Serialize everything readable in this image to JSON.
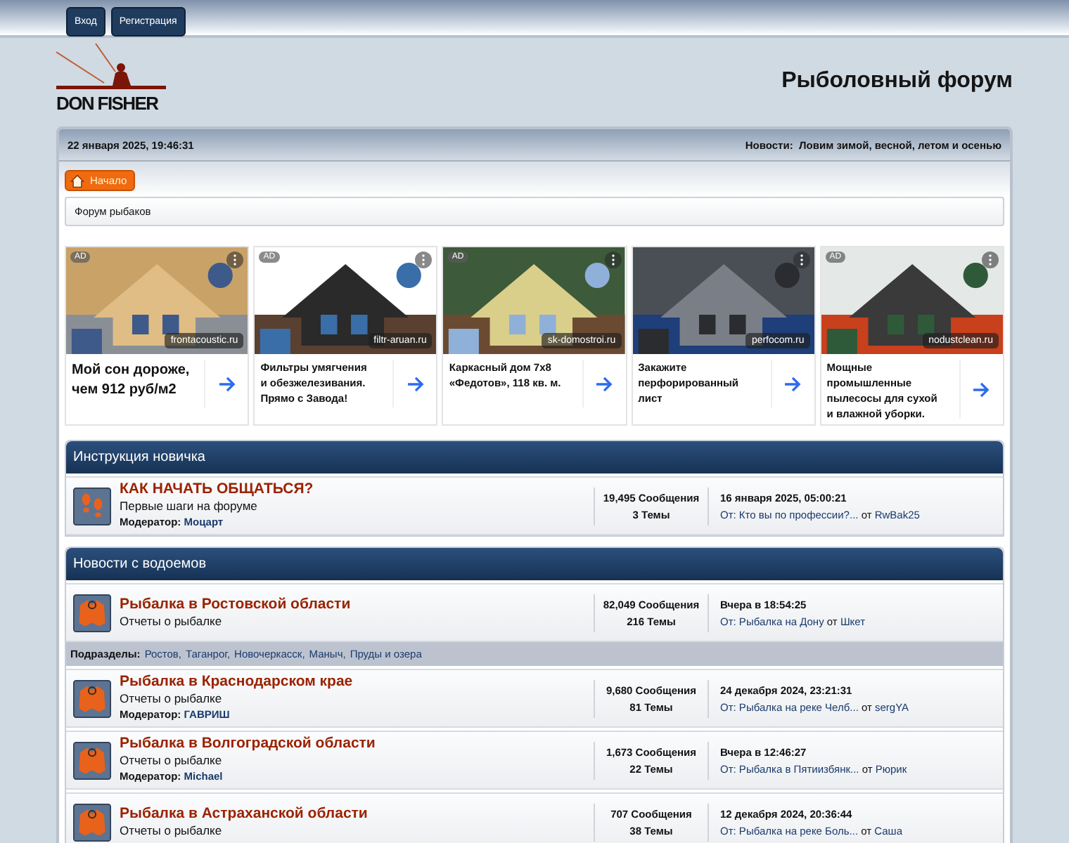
{
  "top_bar": {
    "buttons": [
      "Вход",
      "Регистрация"
    ]
  },
  "header": {
    "logo_text": "DON FISHER",
    "title": "Рыболовный форум"
  },
  "info_bar": {
    "datetime": "22 января 2025, 19:46:31",
    "news_label": "Новости:",
    "news": "Ловим зимой, весной, летом и осенью"
  },
  "home_button": "Начало",
  "breadcrumb": "Форум рыбаков",
  "ads": [
    {
      "kind": "headline",
      "badge": "AD",
      "domain": "frontacoustic.ru",
      "text": "Мой сон дороже,\nчем 912 руб/м2"
    },
    {
      "kind": "text",
      "badge": "AD",
      "domain": "filtr-aruan.ru",
      "text": "Фильтры умягчения\nи обезжелезивания.\nПрямо с Завода!"
    },
    {
      "kind": "text",
      "badge": "AD",
      "domain": "sk-domostroi.ru",
      "text": "Каркасный дом 7х8\n«Федотов», 118 кв. м."
    },
    {
      "kind": "text",
      "domain": "perfocom.ru",
      "text": "Закажите\nперфорированный\nлист"
    },
    {
      "kind": "text",
      "badge": "AD",
      "domain": "nodustclean.ru",
      "text": "Мощные промышленные\nпылесосы для сухой\nи влажной уборки."
    }
  ],
  "categories": [
    {
      "title": "Инструкция новичка",
      "boards": [
        {
          "kind": "steps",
          "name": "КАК НАЧАТЬ ОБЩАТЬСЯ?",
          "description": "Первые шаги на форуме",
          "moderator_label": "Модератор:",
          "moderator": "Моцарт",
          "posts": "19,495 Сообщения",
          "topics": "3 Темы",
          "last_date": "16 января 2025, 05:00:21",
          "last_topic": "От: Кто вы по профессии?...",
          "last_by": "от",
          "last_author": "RwBak25"
        }
      ]
    },
    {
      "title": "Новости с водоемов",
      "boards": [
        {
          "kind": "vest",
          "name": "Рыбалка в Ростовской области",
          "description": "Отчеты о рыбалке",
          "posts": "82,049 Сообщения",
          "topics": "216 Темы",
          "last_date": "Вчера в 18:54:25",
          "last_topic": "От: Рыбалка на Дону",
          "last_by": "от",
          "last_author": "Шкет",
          "subboards_label": "Подразделы:",
          "subboards": [
            "Ростов,",
            "Таганрог,",
            "Новочеркасск,",
            "Маныч,",
            "Пруды и озера"
          ]
        },
        {
          "kind": "vest",
          "name": "Рыбалка в Краснодарском крае",
          "description": "Отчеты о рыбалке",
          "moderator_label": "Модератор:",
          "moderator": "ГАВРИШ",
          "posts": "9,680 Сообщения",
          "topics": "81 Темы",
          "last_date": "24 декабря 2024, 23:21:31",
          "last_topic": "От: Рыбалка на реке Челб...",
          "last_by": "от",
          "last_author": "sergYA"
        },
        {
          "kind": "vest",
          "name": "Рыбалка в Волгоградской области",
          "description": "Отчеты о рыбалке",
          "moderator_label": "Модератор:",
          "moderator": "Michael",
          "posts": "1,673 Сообщения",
          "topics": "22 Темы",
          "last_date": "Вчера в 12:46:27",
          "last_topic": "От: Рыбалка в Пятиизбянк...",
          "last_by": "от",
          "last_author": "Рюрик"
        },
        {
          "kind": "vest",
          "name": "Рыбалка в Астраханской области",
          "description": "Отчеты о рыбалке",
          "posts": "707 Сообщения",
          "topics": "38 Темы",
          "last_date": "12 декабря 2024, 20:36:44",
          "last_topic": "От: Рыбалка на реке Боль...",
          "last_by": "от",
          "last_author": "Саша"
        }
      ]
    }
  ]
}
